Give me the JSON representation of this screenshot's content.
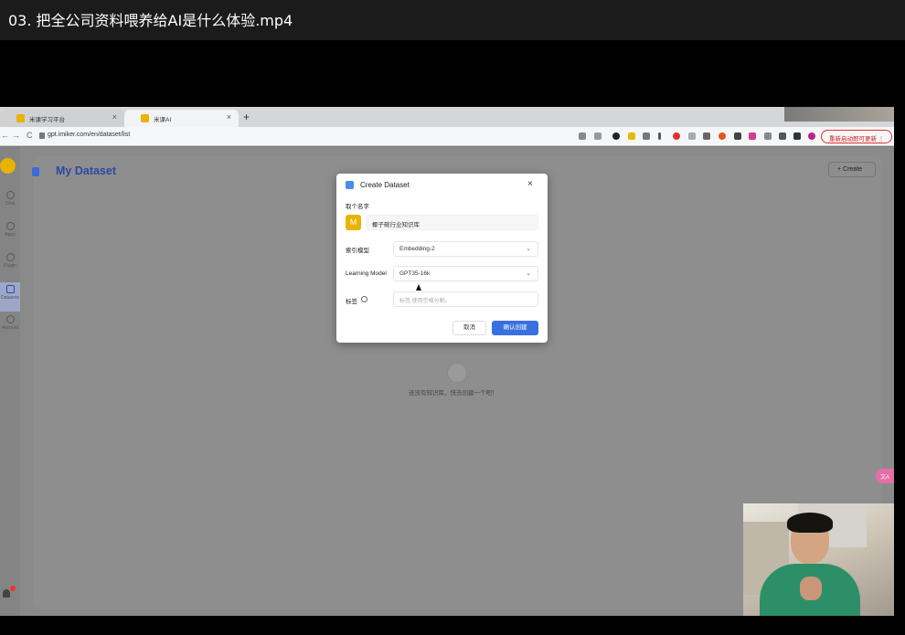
{
  "player": {
    "title": "03. 把全公司资料喂养给AI是什么体验.mp4"
  },
  "browser": {
    "tabs": [
      {
        "label": "米课学习平台",
        "close": "×"
      },
      {
        "label": "米课AI",
        "close": "×"
      }
    ],
    "new_tab": "+",
    "back": "←",
    "forward": "→",
    "reload": "C",
    "url": "gpt.imiker.com/en/dataset/list",
    "update_button": "重新启动即可更新  ⋮",
    "extension_icons": [
      "share-icon",
      "star-icon",
      "ext-dark-icon",
      "ext-folder-icon",
      "ext-doc-icon",
      "pen-icon",
      "ext-red-icon",
      "ext-grid-icon",
      "ext-move-icon",
      "ext-orange-icon",
      "y-icon",
      "ext-pink-icon",
      "ext-cat-icon",
      "puzzle-icon",
      "sidebar-icon",
      "profile-icon"
    ]
  },
  "sidebar": {
    "items": [
      {
        "label": "Chat",
        "icon": "chat-icon"
      },
      {
        "label": "Apps",
        "icon": "robot-icon"
      },
      {
        "label": "Plugin",
        "icon": "puzzle-icon"
      },
      {
        "label": "Datasets",
        "icon": "database-icon"
      },
      {
        "label": "Account",
        "icon": "user-icon"
      }
    ],
    "notification_count": "1"
  },
  "page": {
    "title": "My Dataset",
    "create_button": "+ Create",
    "empty_text": "还没有知识库，快去创建一个吧！"
  },
  "modal": {
    "title": "Create Dataset",
    "close": "×",
    "name_label": "取个名字",
    "name_value": "椰子碗行业知识库",
    "index_model_label": "索引模型",
    "index_model_value": "Embedding-2",
    "learning_model_label": "Learning Model",
    "learning_model_value": "GPT35-16k",
    "tags_label": "标签",
    "tags_placeholder": "标签,使用空格分割。",
    "cancel": "取消",
    "confirm": "确认创建"
  },
  "overlay": {
    "translate": "文A"
  },
  "colors": {
    "accent": "#3870e0",
    "title_blue": "#2c4aa3",
    "brand_yellow": "#e9b300"
  }
}
